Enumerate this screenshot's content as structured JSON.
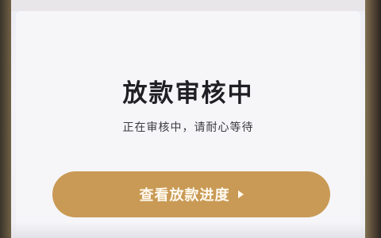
{
  "loan_review": {
    "title": "放款审核中",
    "subtitle": "正在审核中，请耐心等待",
    "progress_button_label": "查看放款进度",
    "progress_button_icon": "play-triangle-icon",
    "accent_color": "#c99a55"
  }
}
